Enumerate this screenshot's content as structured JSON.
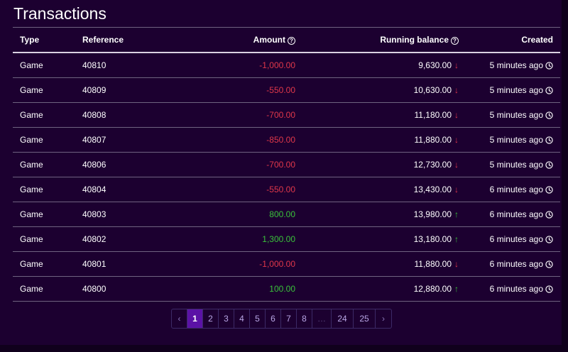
{
  "page": {
    "title": "Transactions"
  },
  "table": {
    "headers": {
      "type": "Type",
      "reference": "Reference",
      "amount": "Amount",
      "running_balance": "Running balance",
      "created": "Created"
    },
    "rows": [
      {
        "type": "Game",
        "reference": "40810",
        "amount": "-1,000.00",
        "direction": "negative",
        "balance": "9,630.00",
        "trend": "down",
        "created": "5 minutes ago"
      },
      {
        "type": "Game",
        "reference": "40809",
        "amount": "-550.00",
        "direction": "negative",
        "balance": "10,630.00",
        "trend": "down",
        "created": "5 minutes ago"
      },
      {
        "type": "Game",
        "reference": "40808",
        "amount": "-700.00",
        "direction": "negative",
        "balance": "11,180.00",
        "trend": "down",
        "created": "5 minutes ago"
      },
      {
        "type": "Game",
        "reference": "40807",
        "amount": "-850.00",
        "direction": "negative",
        "balance": "11,880.00",
        "trend": "down",
        "created": "5 minutes ago"
      },
      {
        "type": "Game",
        "reference": "40806",
        "amount": "-700.00",
        "direction": "negative",
        "balance": "12,730.00",
        "trend": "down",
        "created": "5 minutes ago"
      },
      {
        "type": "Game",
        "reference": "40804",
        "amount": "-550.00",
        "direction": "negative",
        "balance": "13,430.00",
        "trend": "down",
        "created": "6 minutes ago"
      },
      {
        "type": "Game",
        "reference": "40803",
        "amount": "800.00",
        "direction": "positive",
        "balance": "13,980.00",
        "trend": "up",
        "created": "6 minutes ago"
      },
      {
        "type": "Game",
        "reference": "40802",
        "amount": "1,300.00",
        "direction": "positive",
        "balance": "13,180.00",
        "trend": "up",
        "created": "6 minutes ago"
      },
      {
        "type": "Game",
        "reference": "40801",
        "amount": "-1,000.00",
        "direction": "negative",
        "balance": "11,880.00",
        "trend": "down",
        "created": "6 minutes ago"
      },
      {
        "type": "Game",
        "reference": "40800",
        "amount": "100.00",
        "direction": "positive",
        "balance": "12,880.00",
        "trend": "up",
        "created": "6 minutes ago"
      }
    ]
  },
  "icons": {
    "help": "help-circle-icon",
    "clock": "clock-icon",
    "down": "arrow-down-icon",
    "up": "arrow-up-icon"
  },
  "pagination": {
    "prev": "‹",
    "next": "›",
    "pages": [
      "1",
      "2",
      "3",
      "4",
      "5",
      "6",
      "7",
      "8",
      "…",
      "24",
      "25"
    ],
    "current": "1"
  },
  "colors": {
    "negative": "#e0374a",
    "positive": "#3ac23a",
    "active_page": "#5b12a6",
    "panel": "#1c0030"
  }
}
